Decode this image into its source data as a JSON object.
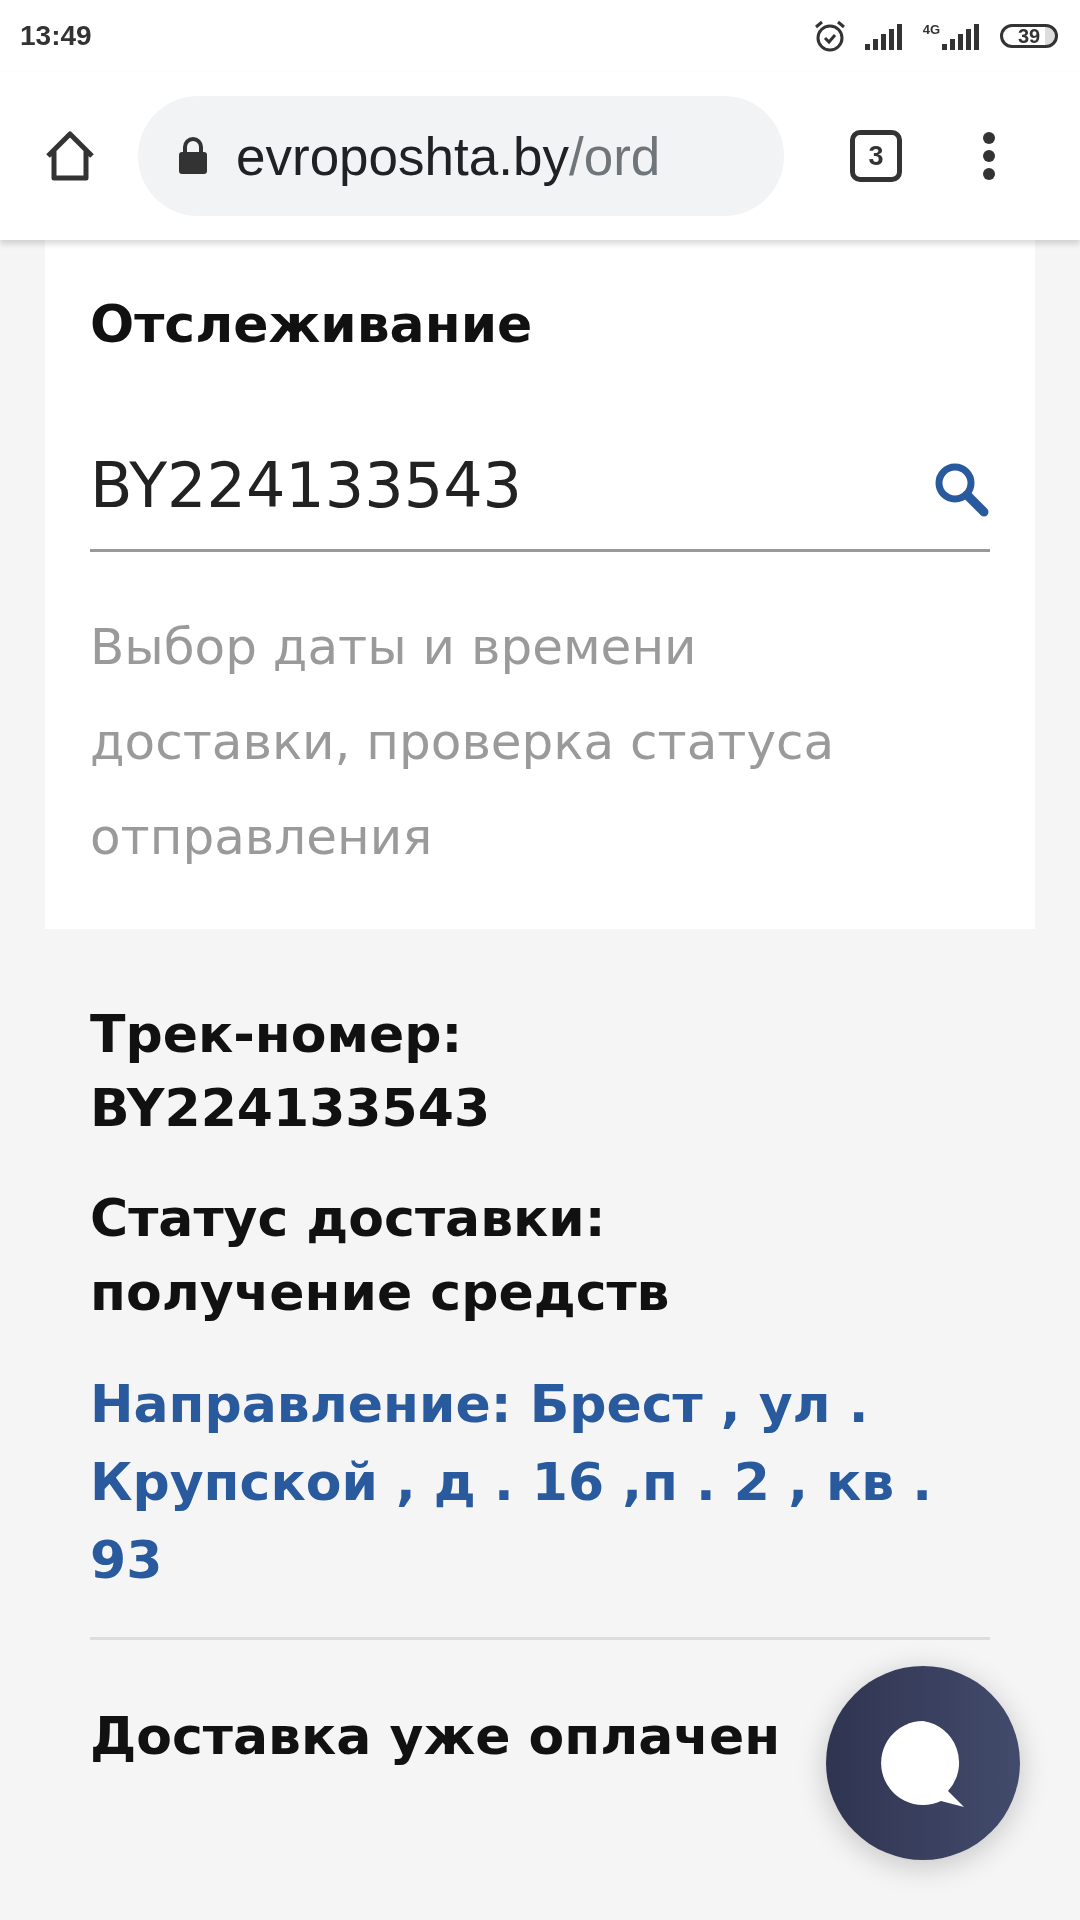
{
  "status_bar": {
    "time": "13:49",
    "network": "4G",
    "battery": "39"
  },
  "browser": {
    "url_host": "evroposhta.by",
    "url_path": "/ord",
    "tab_count": "3"
  },
  "tracking": {
    "title": "Отслеживание",
    "query": "BY224133543",
    "hint": "Выбор даты и времени доставки, проверка статуса отправления"
  },
  "result": {
    "track_label": "Трек-номер:",
    "track_number": "BY224133543",
    "status_label": "Статус доставки:",
    "status_value": "получение средств",
    "direction": "Направление: Брест , ул . Крупской , д . 16 ,п . 2 , кв . 93",
    "payment": "Доставка уже оплачен"
  }
}
